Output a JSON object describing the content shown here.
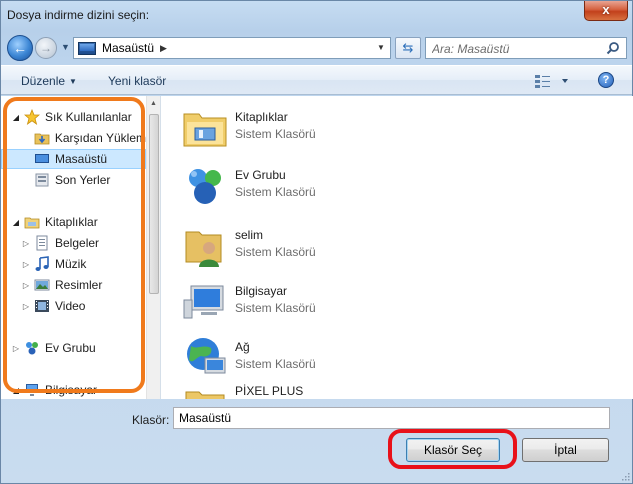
{
  "window": {
    "title": "Dosya indirme dizini seçin:",
    "close_label": "x"
  },
  "nav": {
    "address_location": "Masaüstü",
    "search_placeholder": "Ara: Masaüstü"
  },
  "toolbar": {
    "organize_label": "Düzenle",
    "new_folder_label": "Yeni klasör",
    "help_label": "?"
  },
  "sidebar": {
    "items": [
      {
        "label": "Sık Kullanılanlar",
        "icon": "star-icon"
      },
      {
        "label": "Karşıdan Yüklem",
        "icon": "downloads-folder-icon"
      },
      {
        "label": "Masaüstü",
        "icon": "desktop-icon",
        "selected": true
      },
      {
        "label": "Son Yerler",
        "icon": "recent-places-icon"
      },
      {
        "label": "Kitaplıklar",
        "icon": "libraries-icon"
      },
      {
        "label": "Belgeler",
        "icon": "documents-icon"
      },
      {
        "label": "Müzik",
        "icon": "music-icon"
      },
      {
        "label": "Resimler",
        "icon": "pictures-icon"
      },
      {
        "label": "Video",
        "icon": "video-icon"
      },
      {
        "label": "Ev Grubu",
        "icon": "homegroup-icon"
      },
      {
        "label": "Bilgisayar",
        "icon": "computer-icon"
      }
    ]
  },
  "files": [
    {
      "name": "Kitaplıklar",
      "type": "Sistem Klasörü",
      "icon": "libraries-icon"
    },
    {
      "name": "Ev Grubu",
      "type": "Sistem Klasörü",
      "icon": "homegroup-icon"
    },
    {
      "name": "selim",
      "type": "Sistem Klasörü",
      "icon": "user-folder-icon"
    },
    {
      "name": "Bilgisayar",
      "type": "Sistem Klasörü",
      "icon": "computer-icon"
    },
    {
      "name": "Ağ",
      "type": "Sistem Klasörü",
      "icon": "network-icon"
    },
    {
      "name": "PİXEL PLUS",
      "type": "",
      "icon": "folder-icon"
    }
  ],
  "footer": {
    "folder_label": "Klasör:",
    "folder_value": "Masaüstü",
    "select_button": "Klasör Seç",
    "cancel_button": "İptal"
  },
  "annotations": {
    "nav_highlight_color": "#f07a1c",
    "button_highlight_color": "#e8111a"
  }
}
